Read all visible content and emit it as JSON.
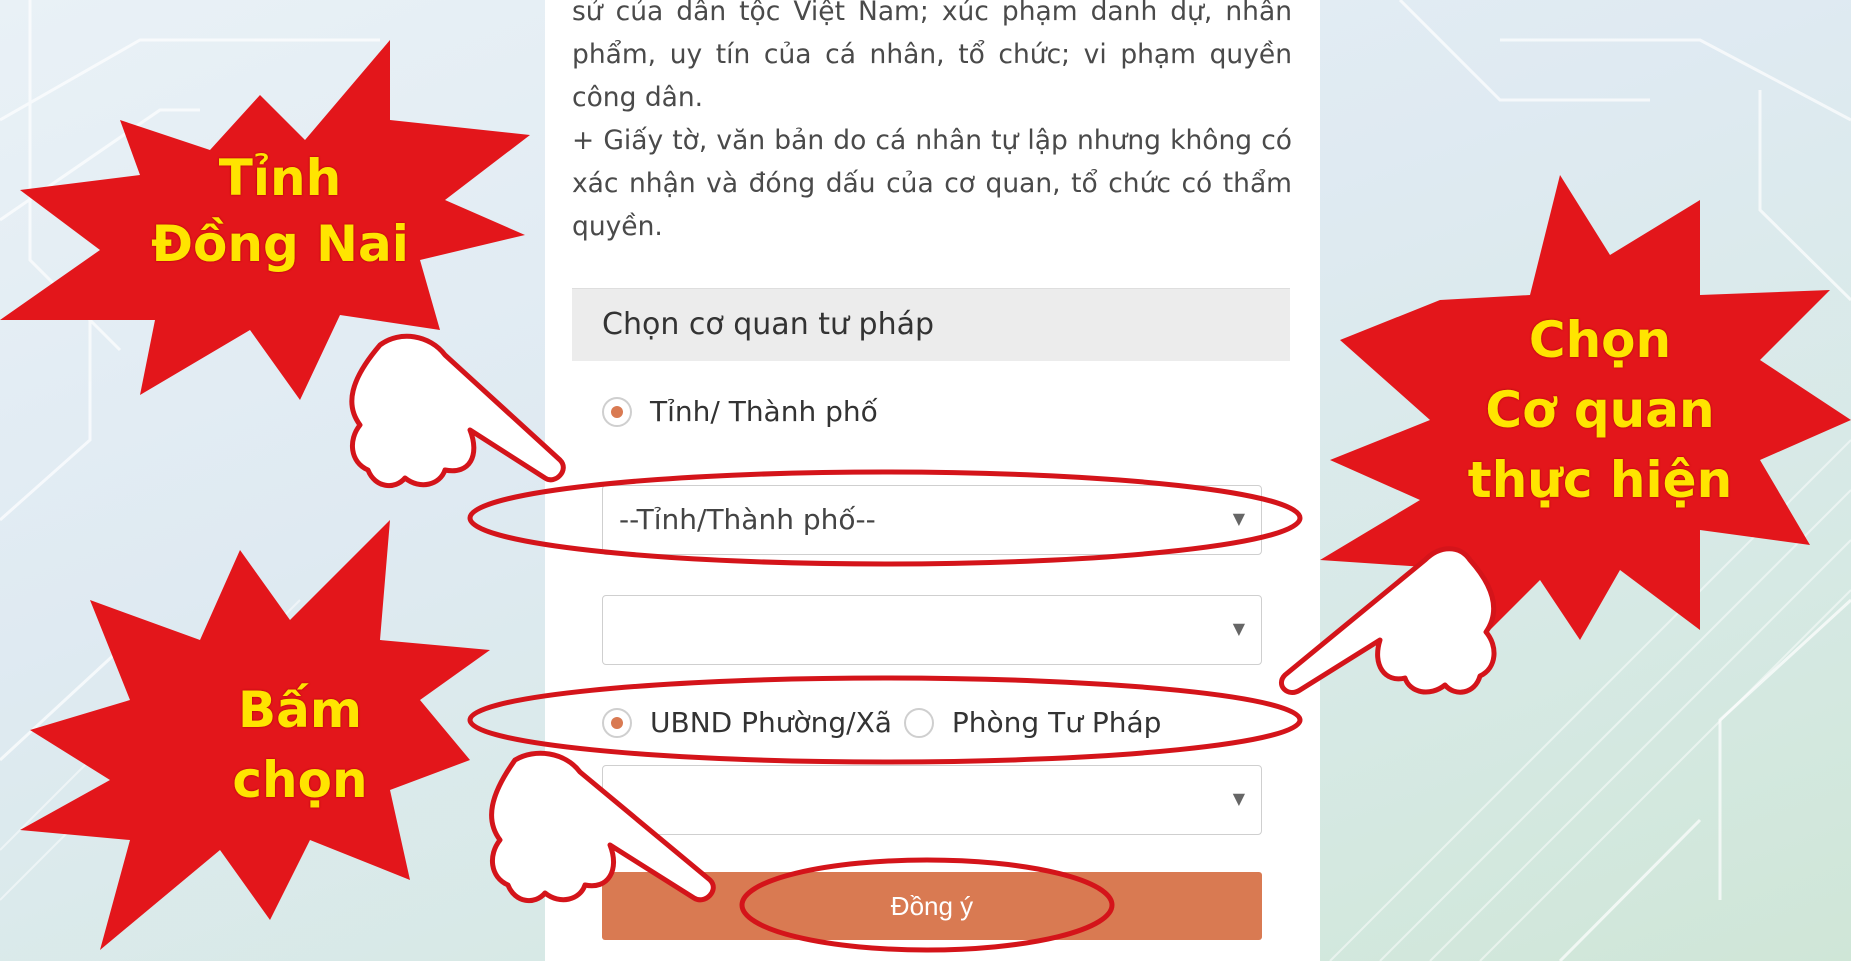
{
  "intro": {
    "line1": "sử của dân tộc Việt Nam; xúc phạm danh dự, nhân phẩm, uy tín của cá nhân, tổ chức; vi phạm quyền công dân.",
    "line2": "+ Giấy tờ, văn bản do cá nhân tự lập nhưng không có xác nhận và đóng dấu của cơ quan, tổ chức có thẩm quyền."
  },
  "form": {
    "title": "Chọn cơ quan tư pháp",
    "level_option": "Tỉnh/ Thành phố",
    "province_select": "--Tỉnh/Thành phố--",
    "district_select": "",
    "option_ward": "UBND Phường/Xã",
    "option_justice": "Phòng Tư Pháp",
    "agency_select": "",
    "submit": "Đồng ý"
  },
  "callouts": {
    "province": [
      "Tỉnh",
      "Đồng Nai"
    ],
    "agency": [
      "Chọn",
      "Cơ quan",
      "thực hiện"
    ],
    "click": [
      "Bấm",
      "chọn"
    ]
  },
  "colors": {
    "accent": "#d97a52",
    "burst_red": "#e3161b",
    "callout_text": "#ffe400"
  }
}
